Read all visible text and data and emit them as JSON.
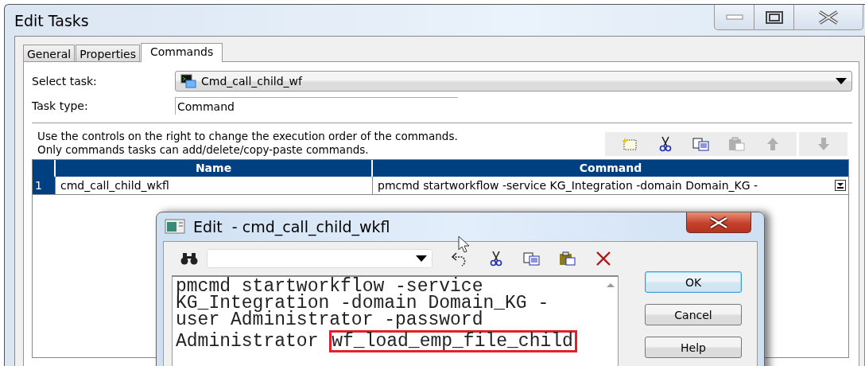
{
  "window": {
    "title": "Edit Tasks"
  },
  "tabs": [
    {
      "label": "General",
      "selected": false
    },
    {
      "label": "Properties",
      "selected": false
    },
    {
      "label": "Commands",
      "selected": true
    }
  ],
  "select_task": {
    "label": "Select task:",
    "value": "Cmd_call_child_wf"
  },
  "task_type": {
    "label": "Task type:",
    "value": "Command"
  },
  "description": "Use the controls on the right to change the execution order of the commands.  Only commands tasks can add/delete/copy-paste commands.",
  "toolbar": [
    {
      "kind": "new",
      "disabled": false
    },
    {
      "kind": "cut",
      "disabled": false
    },
    {
      "kind": "copy",
      "disabled": false
    },
    {
      "kind": "paste",
      "disabled": true
    },
    {
      "kind": "up",
      "disabled": true
    },
    {
      "kind": "down",
      "disabled": true
    }
  ],
  "table": {
    "columns": [
      "Name",
      "Command"
    ],
    "rows": [
      {
        "number": "1",
        "name": "cmd_call_child_wkfl",
        "command": "pmcmd startworkflow -service KG_Integration -domain Domain_KG -"
      }
    ]
  },
  "edit_dialog": {
    "title": "Edit  - cmd_call_child_wkfl",
    "toolbar": [
      {
        "kind": "undo"
      },
      {
        "kind": "cut"
      },
      {
        "kind": "copy"
      },
      {
        "kind": "paste"
      },
      {
        "kind": "delete"
      }
    ],
    "text": "pmcmd startworkflow -service KG_Integration -domain Domain_KG -user Administrator -password Administrator ",
    "highlighted": "wf_load_emp_file_child",
    "buttons": [
      {
        "label": "OK",
        "default": true
      },
      {
        "label": "Cancel",
        "default": false
      },
      {
        "label": "Help",
        "default": false
      }
    ]
  }
}
